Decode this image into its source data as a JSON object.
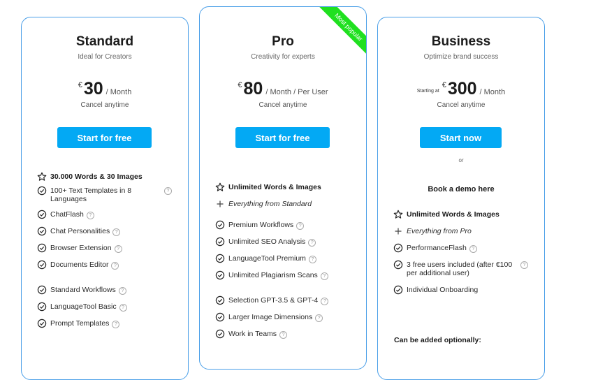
{
  "plans": [
    {
      "title": "Standard",
      "subtitle": "Ideal for Creators",
      "starting_label": "",
      "currency": "€",
      "price": "30",
      "period": "/  Month",
      "cancel_note": "Cancel anytime",
      "cta_label": "Start for free",
      "features": [
        {
          "icon": "star-icon",
          "text": "30.000 Words & 30 Images",
          "style": "bold",
          "help": false
        },
        {
          "icon": "check-circle-icon",
          "text": "100+ Text Templates in 8 Languages",
          "style": "normal",
          "help": true
        },
        {
          "icon": "check-circle-icon",
          "text": "ChatFlash",
          "style": "normal",
          "help": true
        },
        {
          "icon": "check-circle-icon",
          "text": "Chat Personalities",
          "style": "normal",
          "help": true
        },
        {
          "icon": "check-circle-icon",
          "text": "Browser Extension",
          "style": "normal",
          "help": true
        },
        {
          "icon": "check-circle-icon",
          "text": "Documents Editor",
          "style": "normal",
          "help": true
        },
        {
          "icon": "check-circle-icon",
          "text": "Standard Workflows",
          "style": "normal",
          "help": true
        },
        {
          "icon": "check-circle-icon",
          "text": "LanguageTool Basic",
          "style": "normal",
          "help": true
        },
        {
          "icon": "check-circle-icon",
          "text": "Prompt Templates",
          "style": "normal",
          "help": true
        }
      ]
    },
    {
      "title": "Pro",
      "subtitle": "Creativity for experts",
      "starting_label": "",
      "currency": "€",
      "price": "80",
      "period": "/  Month / Per User",
      "cancel_note": "Cancel anytime",
      "cta_label": "Start for free",
      "badge": "Most popular",
      "badge_color": "#1fe01f",
      "features": [
        {
          "icon": "star-icon",
          "text": "Unlimited Words & Images",
          "style": "bold",
          "help": false
        },
        {
          "icon": "plus-icon",
          "text": "Everything from Standard",
          "style": "italic",
          "help": false
        },
        {
          "icon": "check-circle-icon",
          "text": "Premium Workflows",
          "style": "normal",
          "help": true
        },
        {
          "icon": "check-circle-icon",
          "text": "Unlimited SEO Analysis",
          "style": "normal",
          "help": true
        },
        {
          "icon": "check-circle-icon",
          "text": "LanguageTool Premium",
          "style": "normal",
          "help": true
        },
        {
          "icon": "check-circle-icon",
          "text": "Unlimited Plagiarism Scans",
          "style": "normal",
          "help": true
        },
        {
          "icon": "check-circle-icon",
          "text": "Selection GPT-3.5 & GPT-4",
          "style": "normal",
          "help": true
        },
        {
          "icon": "check-circle-icon",
          "text": "Larger Image Dimensions",
          "style": "normal",
          "help": true
        },
        {
          "icon": "check-circle-icon",
          "text": "Work in Teams",
          "style": "normal",
          "help": true
        }
      ]
    },
    {
      "title": "Business",
      "subtitle": "Optimize brand success",
      "starting_label": "Starting at",
      "currency": "€",
      "price": "300",
      "period": "/  Month",
      "cancel_note": "Cancel anytime",
      "cta_label": "Start now",
      "or_label": "or",
      "demo_label": "Book a demo here",
      "optional_label": "Can be added optionally:",
      "features": [
        {
          "icon": "star-icon",
          "text": "Unlimited Words & Images",
          "style": "bold",
          "help": false
        },
        {
          "icon": "plus-icon",
          "text": "Everything from Pro",
          "style": "italic",
          "help": false
        },
        {
          "icon": "check-circle-icon",
          "text": "PerformanceFlash",
          "style": "normal",
          "help": true
        },
        {
          "icon": "check-circle-icon",
          "text": "3 free users included (after €100 per additional user)",
          "style": "normal",
          "help": true
        },
        {
          "icon": "check-circle-icon",
          "text": "Individual Onboarding",
          "style": "normal",
          "help": false
        }
      ]
    }
  ],
  "colors": {
    "accent": "#03a9f4",
    "card_border": "#4a9fe8",
    "badge": "#1fe01f"
  },
  "help_glyph": "?"
}
